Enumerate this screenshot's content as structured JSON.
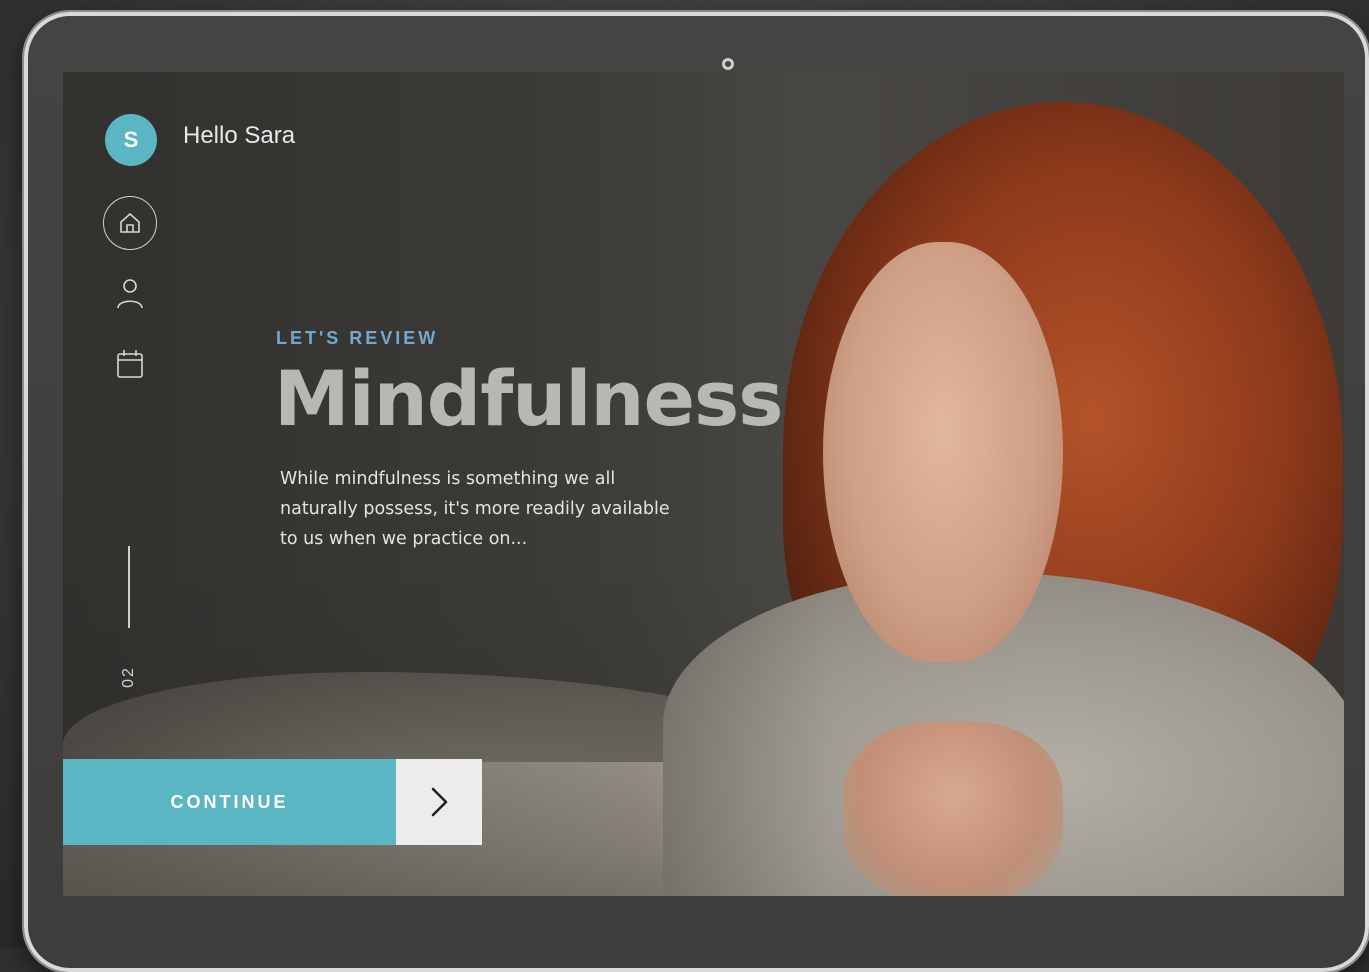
{
  "user": {
    "initial": "S",
    "greeting": "Hello Sara"
  },
  "nav": {
    "items": [
      {
        "icon": "home-icon",
        "active": true
      },
      {
        "icon": "user-icon",
        "active": false
      },
      {
        "icon": "calendar-icon",
        "active": false
      }
    ]
  },
  "page": {
    "number": "02"
  },
  "lesson": {
    "eyebrow": "LET'S REVIEW",
    "title": "Mindfulness",
    "description": "While mindfulness is something we all naturally possess, it's more readily available to us when we practice on..."
  },
  "actions": {
    "continue_label": "CONTINUE",
    "next_icon": "chevron-right-icon"
  },
  "colors": {
    "accent": "#5ab6c3",
    "eyebrow": "#74a9cf",
    "title": "#b9b7b3"
  }
}
